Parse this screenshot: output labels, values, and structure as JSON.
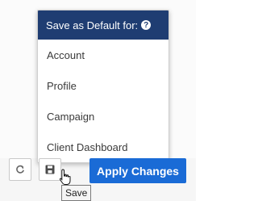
{
  "menu": {
    "header": "Save as Default for:",
    "items": [
      "Account",
      "Profile",
      "Campaign",
      "Client Dashboard"
    ]
  },
  "toolbar": {
    "apply_label": "Apply Changes"
  },
  "tooltip": {
    "text": "Save"
  },
  "colors": {
    "header_bg": "#1f3d72",
    "apply_bg": "#1a6bd6"
  },
  "icons": {
    "refresh": "refresh-icon",
    "save": "floppy-disk-icon",
    "help": "question-circle-icon",
    "cursor": "hand-pointer-icon"
  }
}
